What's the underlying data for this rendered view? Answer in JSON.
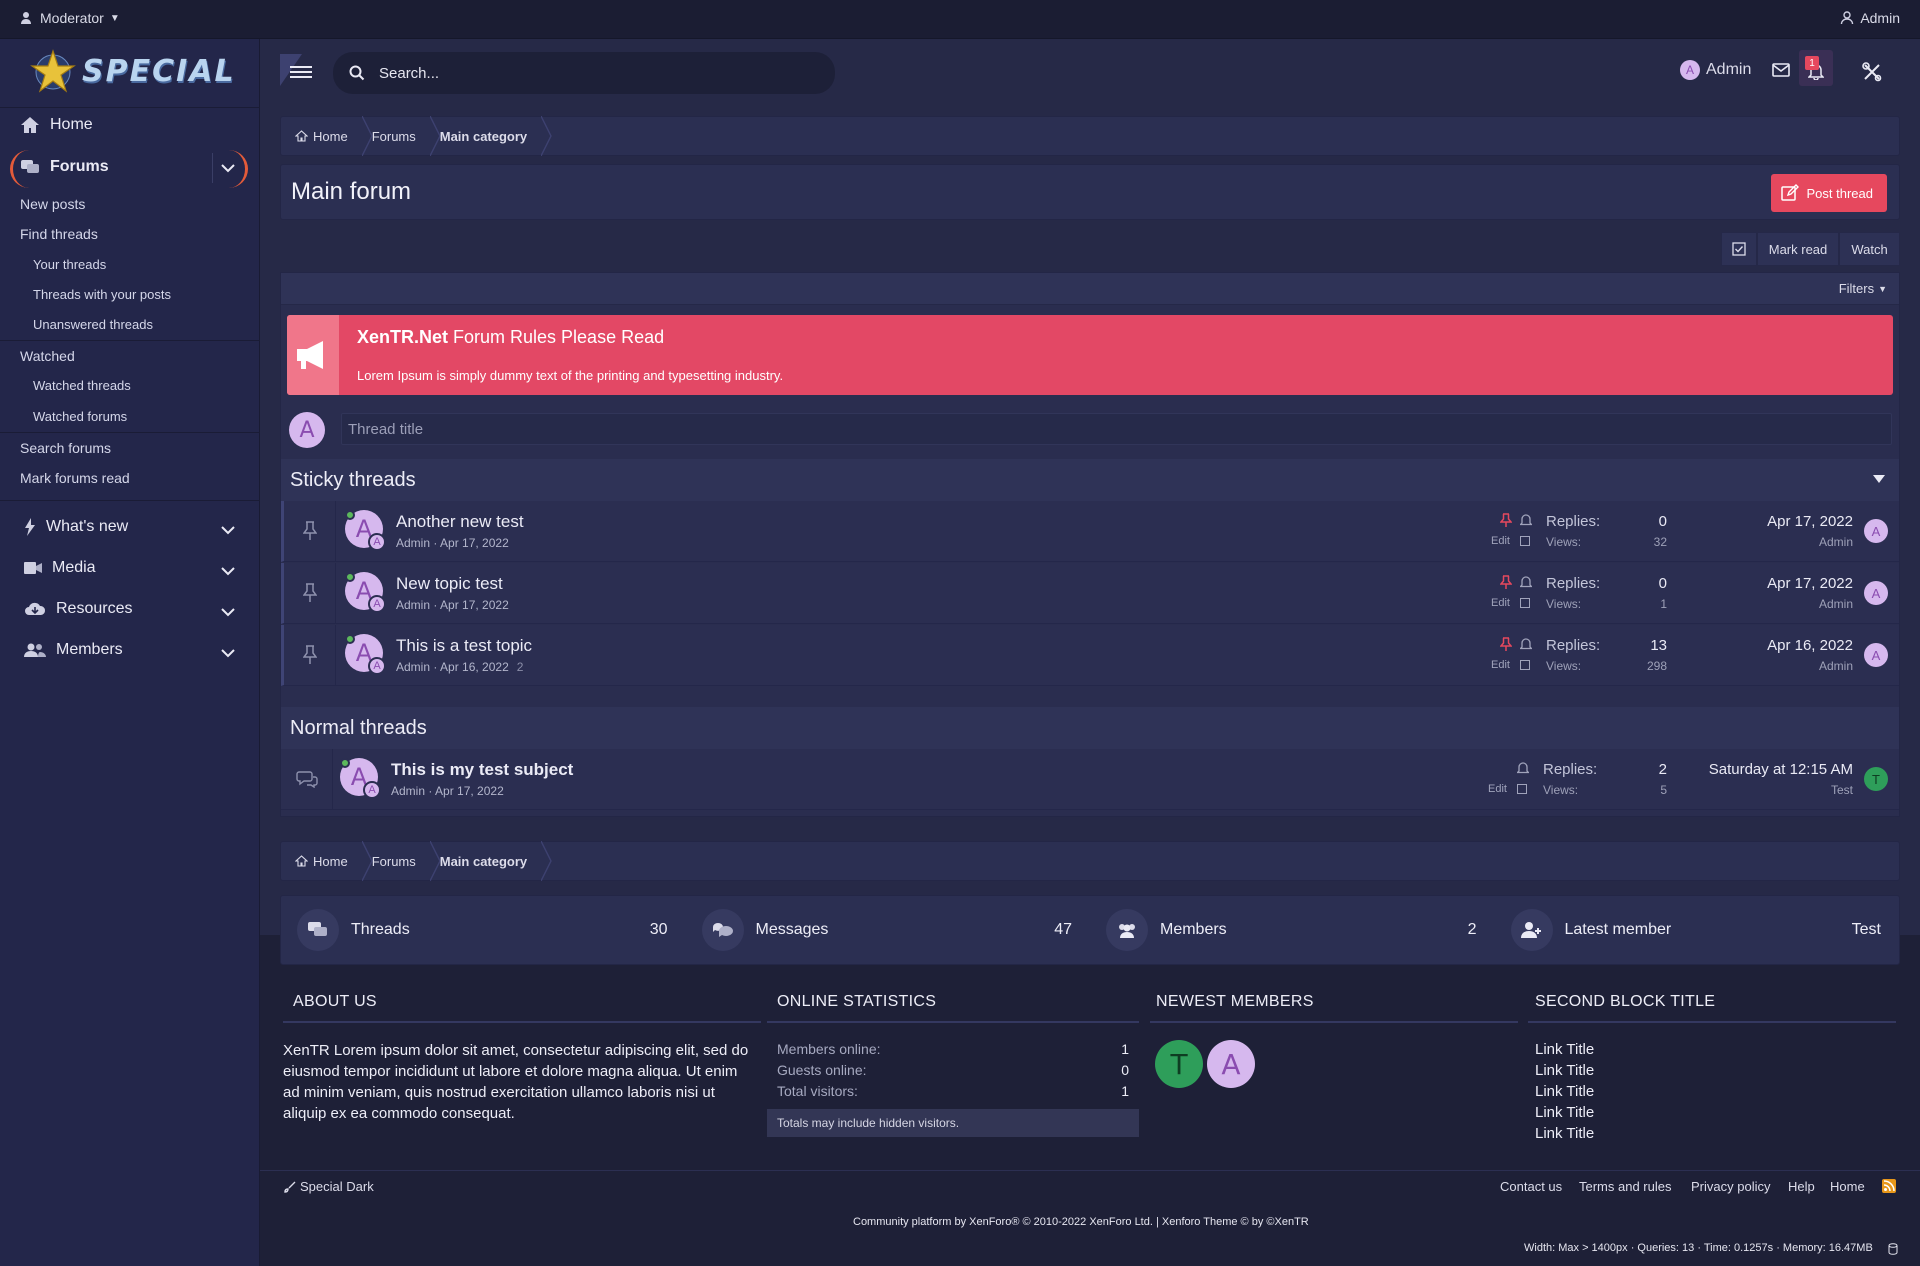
{
  "topbar": {
    "moderator_label": "Moderator",
    "admin_label": "Admin"
  },
  "brand": {
    "logo_text": "SPECIAL"
  },
  "sidebar": {
    "home": "Home",
    "forums": "Forums",
    "sub": [
      "New posts",
      "Find threads",
      "Your threads",
      "Threads with your posts",
      "Unanswered threads",
      "Watched",
      "Watched threads",
      "Watched forums",
      "Search forums",
      "Mark forums read"
    ],
    "whats_new": "What's new",
    "media": "Media",
    "resources": "Resources",
    "members": "Members"
  },
  "header": {
    "search_placeholder": "Search...",
    "user_name": "Admin",
    "user_initial": "A",
    "alert_count": "1"
  },
  "breadcrumb": [
    "Home",
    "Forums",
    "Main category"
  ],
  "page": {
    "title": "Main forum",
    "post_thread": "Post thread",
    "mark_read": "Mark read",
    "watch": "Watch",
    "filters": "Filters"
  },
  "notice": {
    "title_bold": "XenTR.Net",
    "title_rest": " Forum Rules Please Read",
    "body": "Lorem Ipsum is simply dummy text of the printing and typesetting industry."
  },
  "quick_thread": {
    "avatar": "A",
    "placeholder": "Thread title"
  },
  "sections": {
    "sticky": "Sticky threads",
    "normal": "Normal threads"
  },
  "labels": {
    "replies": "Replies:",
    "views": "Views:",
    "edit": "Edit"
  },
  "sticky_threads": [
    {
      "title": "Another new test",
      "author": "Admin",
      "date": "Apr 17, 2022",
      "pages": "",
      "replies": "0",
      "views": "32",
      "last_date": "Apr 17, 2022",
      "last_user": "Admin",
      "last_initial": "A"
    },
    {
      "title": "New topic test",
      "author": "Admin",
      "date": "Apr 17, 2022",
      "pages": "",
      "replies": "0",
      "views": "1",
      "last_date": "Apr 17, 2022",
      "last_user": "Admin",
      "last_initial": "A"
    },
    {
      "title": "This is a test topic",
      "author": "Admin",
      "date": "Apr 16, 2022",
      "pages": "2",
      "replies": "13",
      "views": "298",
      "last_date": "Apr 16, 2022",
      "last_user": "Admin",
      "last_initial": "A"
    }
  ],
  "normal_threads": [
    {
      "title": "This is my test subject",
      "author": "Admin",
      "date": "Apr 17, 2022",
      "replies": "2",
      "views": "5",
      "last_date": "Saturday at 12:15 AM",
      "last_user": "Test",
      "last_initial": "T"
    }
  ],
  "forum_stats": [
    {
      "label": "Threads",
      "value": "30"
    },
    {
      "label": "Messages",
      "value": "47"
    },
    {
      "label": "Members",
      "value": "2"
    },
    {
      "label": "Latest member",
      "value": "Test"
    }
  ],
  "footer_blocks": {
    "about": {
      "title": "ABOUT US",
      "text": "XenTR Lorem ipsum dolor sit amet, consectetur adipiscing elit, sed do eiusmod tempor incididunt ut labore et dolore magna aliqua. Ut enim ad minim veniam, quis nostrud exercitation ullamco laboris nisi ut aliquip ex ea commodo consequat."
    },
    "online": {
      "title": "ONLINE STATISTICS",
      "rows": [
        {
          "label": "Members online:",
          "value": "1"
        },
        {
          "label": "Guests online:",
          "value": "0"
        },
        {
          "label": "Total visitors:",
          "value": "1"
        }
      ],
      "note": "Totals may include hidden visitors."
    },
    "newest": {
      "title": "NEWEST MEMBERS",
      "members": [
        "T",
        "A"
      ]
    },
    "second": {
      "title": "SECOND BLOCK TITLE",
      "links": [
        "Link Title",
        "Link Title",
        "Link Title",
        "Link Title",
        "Link Title"
      ]
    }
  },
  "footer": {
    "style_name": "Special Dark",
    "links": [
      "Contact us",
      "Terms and rules",
      "Privacy policy",
      "Help",
      "Home"
    ],
    "copyright": "Community platform by XenForo® © 2010-2022 XenForo Ltd. | Xenforo Theme © by ©XenTR",
    "debug": "Width: Max > 1400px · Queries: 13 · Time: 0.1257s · Memory: 16.47MB"
  },
  "colors": {
    "accent_red": "#e6485e",
    "notice_bg": "#e34865",
    "online_green": "#5cb85c",
    "avatar_purple": "#d6b8ee",
    "avatar_green": "#2e9e5a"
  }
}
